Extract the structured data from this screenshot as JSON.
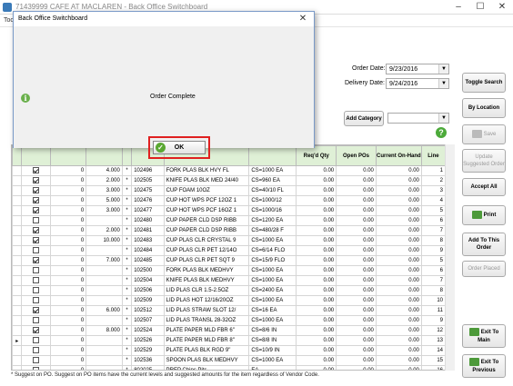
{
  "window": {
    "title": "71439999 CAFE AT MACLAREN - Back Office Switchboard",
    "menu_partial": "Too"
  },
  "order": {
    "order_date_label": "Order Date:",
    "order_date": "9/23/2016",
    "delivery_date_label": "Delivery Date:",
    "delivery_date": "9/24/2016",
    "add_category": "Add Category",
    "category_value": ""
  },
  "buttons": {
    "toggle_search": "Toggle Search",
    "by_location": "By Location",
    "save": "Save",
    "update_suggested": "Update Suggested Order",
    "accept_all": "Accept All",
    "print": "Print",
    "add_to_order": "Add To This Order",
    "order_placed": "Order Placed",
    "exit_main": "Exit To Main",
    "exit_previous": "Exit To Previous"
  },
  "grid": {
    "headers": [
      "",
      "",
      "",
      "",
      "",
      "",
      "",
      "",
      "Req'd Qty",
      "Open POs",
      "Current On-Hand",
      "Line"
    ],
    "rows": [
      {
        "checked": true,
        "a": "0",
        "qty": "4.000",
        "star": "*",
        "code": "102496",
        "desc": "FORK PLAS BLK HVY FL",
        "pack": "CS=1000 EA",
        "req": "0.00",
        "open": "0.00",
        "onhand": "0.00",
        "line": "1"
      },
      {
        "checked": true,
        "a": "0",
        "qty": "2.000",
        "star": "*",
        "code": "102505",
        "desc": "KNIFE PLAS BLK MED 24/40",
        "pack": "CS=960 EA",
        "req": "0.00",
        "open": "0.00",
        "onhand": "0.00",
        "line": "2"
      },
      {
        "checked": true,
        "a": "0",
        "qty": "3.000",
        "star": "*",
        "code": "102475",
        "desc": "CUP FOAM 10OZ",
        "pack": "CS=40/10 FL",
        "req": "0.00",
        "open": "0.00",
        "onhand": "0.00",
        "line": "3"
      },
      {
        "checked": true,
        "a": "0",
        "qty": "5.000",
        "star": "*",
        "code": "102476",
        "desc": "CUP HOT WPS PCF 12OZ 1",
        "pack": "CS=1000/12",
        "req": "0.00",
        "open": "0.00",
        "onhand": "0.00",
        "line": "4"
      },
      {
        "checked": true,
        "a": "0",
        "qty": "3.000",
        "star": "*",
        "code": "102477",
        "desc": "CUP HOT WPS PCF 16OZ 1",
        "pack": "CS=1000/16",
        "req": "0.00",
        "open": "0.00",
        "onhand": "0.00",
        "line": "5"
      },
      {
        "checked": false,
        "a": "0",
        "qty": "",
        "star": "*",
        "code": "102480",
        "desc": "CUP PAPER CLD DSP RIBB",
        "pack": "CS=1200 EA",
        "req": "0.00",
        "open": "0.00",
        "onhand": "0.00",
        "line": "6"
      },
      {
        "checked": true,
        "a": "0",
        "qty": "2.000",
        "star": "*",
        "code": "102481",
        "desc": "CUP PAPER CLD DSP RIBB",
        "pack": "CS=480/28 F",
        "req": "0.00",
        "open": "0.00",
        "onhand": "0.00",
        "line": "7"
      },
      {
        "checked": true,
        "a": "0",
        "qty": "10.000",
        "star": "*",
        "code": "102483",
        "desc": "CUP PLAS CLR CRYSTAL 9",
        "pack": "CS=1000 EA",
        "req": "0.00",
        "open": "0.00",
        "onhand": "0.00",
        "line": "8"
      },
      {
        "checked": false,
        "a": "0",
        "qty": "",
        "star": "*",
        "code": "102484",
        "desc": "CUP PLAS CLR PET 12/14O",
        "pack": "CS=6/14 FLO",
        "req": "0.00",
        "open": "0.00",
        "onhand": "0.00",
        "line": "9"
      },
      {
        "checked": true,
        "a": "0",
        "qty": "7.000",
        "star": "*",
        "code": "102485",
        "desc": "CUP PLAS CLR PET SQT 9",
        "pack": "CS=15/9 FLO",
        "req": "0.00",
        "open": "0.00",
        "onhand": "0.00",
        "line": "5"
      },
      {
        "checked": false,
        "a": "0",
        "qty": "",
        "star": "*",
        "code": "102500",
        "desc": "FORK PLAS BLK MEDHVY",
        "pack": "CS=1000 EA",
        "req": "0.00",
        "open": "0.00",
        "onhand": "0.00",
        "line": "6"
      },
      {
        "checked": false,
        "a": "0",
        "qty": "",
        "star": "*",
        "code": "102504",
        "desc": "KNIFE PLAS BLK MEDHVY",
        "pack": "CS=1000 EA",
        "req": "0.00",
        "open": "0.00",
        "onhand": "0.00",
        "line": "7"
      },
      {
        "checked": false,
        "a": "0",
        "qty": "",
        "star": "*",
        "code": "102506",
        "desc": "LID PLAS CLR 1.5-2.5OZ",
        "pack": "CS=2400 EA",
        "req": "0.00",
        "open": "0.00",
        "onhand": "0.00",
        "line": "8"
      },
      {
        "checked": false,
        "a": "0",
        "qty": "",
        "star": "*",
        "code": "102509",
        "desc": "LID PLAS HOT 12/16/20OZ",
        "pack": "CS=1000 EA",
        "req": "0.00",
        "open": "0.00",
        "onhand": "0.00",
        "line": "10"
      },
      {
        "checked": true,
        "a": "0",
        "qty": "6.000",
        "star": "*",
        "code": "102512",
        "desc": "LID PLAS STRAW SLOT 12/",
        "pack": "CS=16 EA",
        "req": "0.00",
        "open": "0.00",
        "onhand": "0.00",
        "line": "11"
      },
      {
        "checked": false,
        "a": "0",
        "qty": "",
        "star": "*",
        "code": "102507",
        "desc": "LID PLAS TRANSL 28-32OZ",
        "pack": "CS=1000 EA",
        "req": "0.00",
        "open": "0.00",
        "onhand": "0.00",
        "line": "9"
      },
      {
        "checked": true,
        "a": "0",
        "qty": "8.000",
        "star": "*",
        "code": "102524",
        "desc": "PLATE PAPER MLD FBR 6\"",
        "pack": "CS=8/6 IN",
        "req": "0.00",
        "open": "0.00",
        "onhand": "0.00",
        "line": "12"
      },
      {
        "checked": false,
        "a": "0",
        "qty": "",
        "star": "*",
        "code": "102526",
        "desc": "PLATE PAPER MLD FBR 8\"",
        "pack": "CS=8/8 IN",
        "req": "0.00",
        "open": "0.00",
        "onhand": "0.00",
        "line": "13",
        "pointer": true
      },
      {
        "checked": false,
        "a": "0",
        "qty": "",
        "star": "*",
        "code": "102529",
        "desc": "PLATE PLAS BLK RGD 9\"",
        "pack": "CS=10/9 IN",
        "req": "0.00",
        "open": "0.00",
        "onhand": "0.00",
        "line": "14"
      },
      {
        "checked": false,
        "a": "0",
        "qty": "",
        "star": "*",
        "code": "102536",
        "desc": "SPOON PLAS BLK MEDHVY",
        "pack": "CS=1000 EA",
        "req": "0.00",
        "open": "0.00",
        "onhand": "0.00",
        "line": "15"
      },
      {
        "checked": false,
        "a": "0",
        "qty": "",
        "star": "*",
        "code": "802025",
        "desc": "PREP Chips Pits",
        "pack": "EA",
        "req": "0.00",
        "open": "0.00",
        "onhand": "0.00",
        "line": "16"
      }
    ]
  },
  "footnote": "* Suggest on PO.  Suggest on PO items have the current levels and suggested amounts for the item regardless of Vendor Code.",
  "dialog": {
    "title": "Back Office Switchboard",
    "message": "Order Complete",
    "ok": "OK"
  }
}
